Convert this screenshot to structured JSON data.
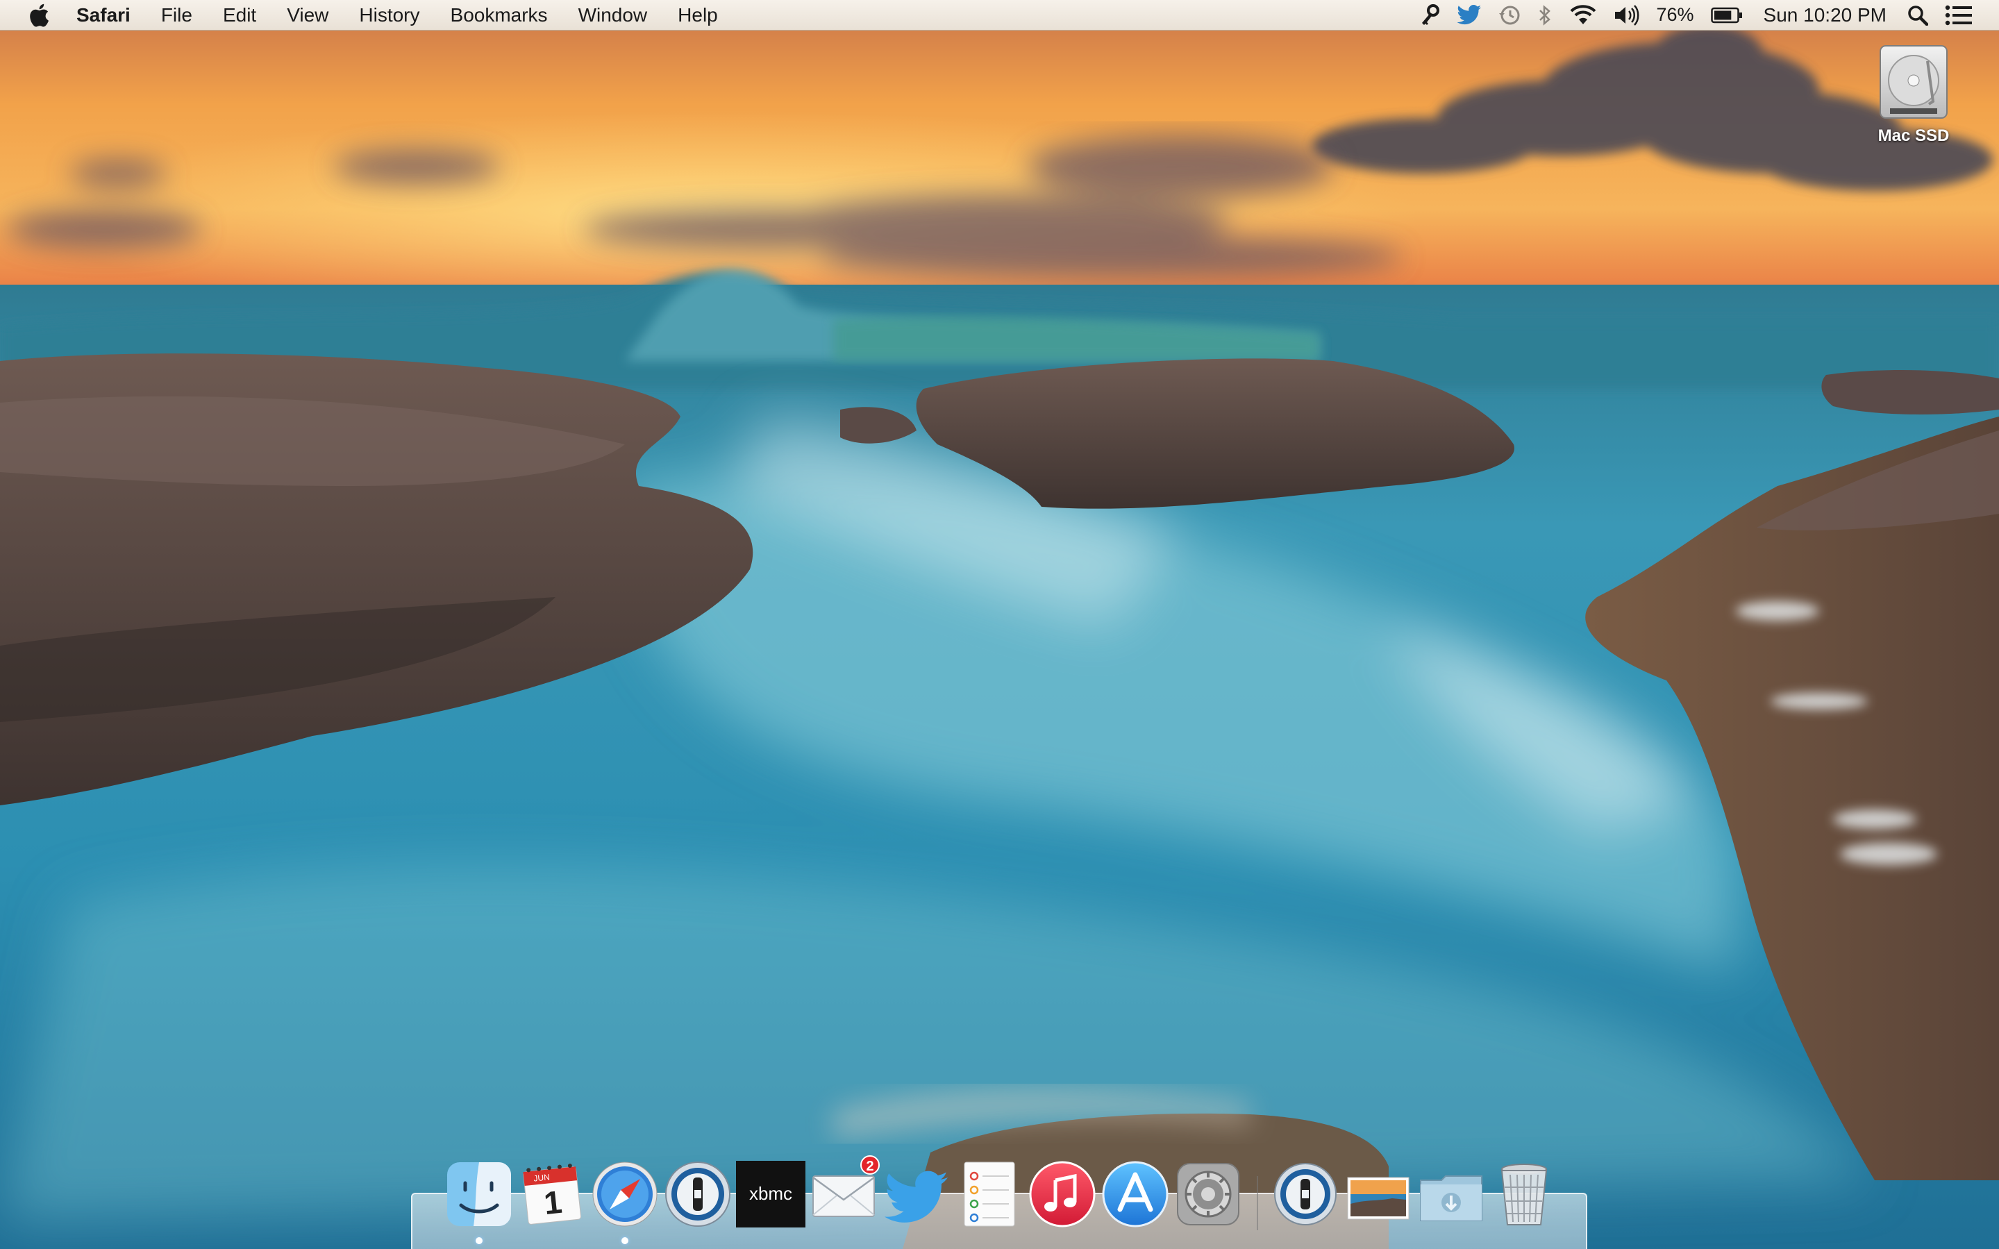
{
  "menubar": {
    "apple_icon": "apple-logo-icon",
    "app_name": "Safari",
    "items": [
      "File",
      "Edit",
      "View",
      "History",
      "Bookmarks",
      "Window",
      "Help"
    ],
    "status_icons": [
      "keychain-access-icon",
      "twitter-icon",
      "time-machine-icon",
      "bluetooth-icon",
      "wifi-icon",
      "volume-icon"
    ],
    "battery_percent": "76%",
    "battery_level": 0.76,
    "clock": "Sun 10:20 PM",
    "spotlight_icon": "spotlight-search-icon",
    "notification_icon": "notification-center-icon"
  },
  "desktop": {
    "drive_label": "Mac SSD",
    "drive_icon": "hard-drive-icon"
  },
  "dock": {
    "apps": [
      {
        "name": "Finder",
        "icon": "finder-icon",
        "running": true
      },
      {
        "name": "Calendar",
        "icon": "calendar-icon",
        "month": "JUN",
        "day": "1"
      },
      {
        "name": "Safari",
        "icon": "safari-icon",
        "running": true
      },
      {
        "name": "1Password",
        "icon": "1password-icon"
      },
      {
        "name": "XBMC",
        "icon": "xbmc-icon",
        "logo_text": "xbmc"
      },
      {
        "name": "Mail",
        "icon": "mail-icon",
        "badge": "2"
      },
      {
        "name": "Twitter",
        "icon": "twitter-icon"
      },
      {
        "name": "Reminders",
        "icon": "reminders-icon"
      },
      {
        "name": "iTunes",
        "icon": "itunes-icon"
      },
      {
        "name": "App Store",
        "icon": "app-store-icon"
      },
      {
        "name": "System Preferences",
        "icon": "system-preferences-icon"
      }
    ],
    "right_items": [
      {
        "name": "1Password mini",
        "icon": "1password-icon"
      },
      {
        "name": "Photo",
        "icon": "photo-thumbnail-icon"
      },
      {
        "name": "Downloads",
        "icon": "downloads-folder-icon"
      },
      {
        "name": "Trash",
        "icon": "trash-icon"
      }
    ]
  },
  "colors": {
    "sky_top": "#e88a3c",
    "sky_glow": "#f7c25a",
    "water": "#2f8fb0",
    "foam": "#cfe9ee",
    "rock": "#5b4a45"
  }
}
